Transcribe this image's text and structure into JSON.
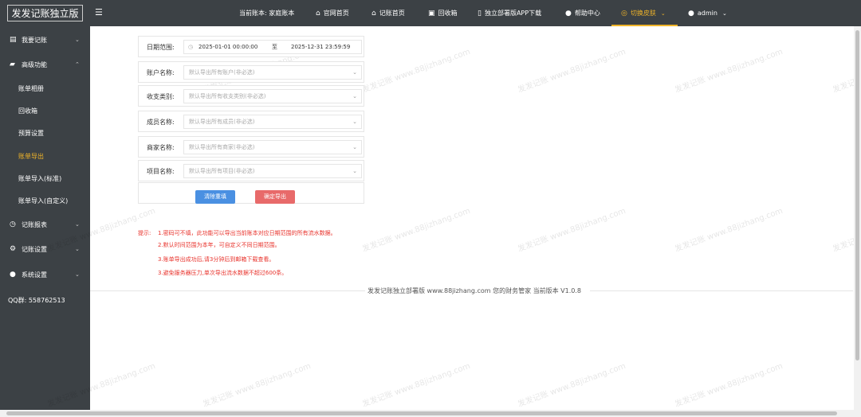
{
  "header": {
    "logo": "发发记账独立版",
    "current_ledger": "当前账本: 家庭账本",
    "nav": [
      {
        "label": "官网首页",
        "icon": "home-icon"
      },
      {
        "label": "记账首页",
        "icon": "home-icon"
      },
      {
        "label": "回收箱",
        "icon": "trash-icon"
      },
      {
        "label": "独立部署版APP下载",
        "icon": "phone-icon"
      },
      {
        "label": "帮助中心",
        "icon": "help-icon"
      },
      {
        "label": "切换皮肤",
        "icon": "palette-icon"
      },
      {
        "label": "admin",
        "icon": "user-icon"
      }
    ]
  },
  "sidebar": {
    "items": [
      {
        "label": "我要记账",
        "icon": "book-icon"
      },
      {
        "label": "高级功能",
        "icon": "briefcase-icon"
      },
      {
        "label": "记账报表",
        "icon": "clock-icon"
      },
      {
        "label": "记账设置",
        "icon": "gear-icon"
      },
      {
        "label": "系统设置",
        "icon": "user-icon"
      }
    ],
    "sub_items": [
      "账单相册",
      "回收箱",
      "预算设置",
      "账单导出",
      "账单导入(标准)",
      "账单导入(自定义)"
    ],
    "qq": "QQ群: 558762513"
  },
  "form": {
    "date_label": "日期范围:",
    "date_start": "2025-01-01 00:00:00",
    "date_sep": "至",
    "date_end": "2025-12-31 23:59:59",
    "fields": [
      {
        "label": "账户名称:",
        "placeholder": "默认导出所有账户(非必选)"
      },
      {
        "label": "收支类别:",
        "placeholder": "默认导出所有收支类别(非必选)"
      },
      {
        "label": "成员名称:",
        "placeholder": "默认导出所有成员(非必选)"
      },
      {
        "label": "商家名称:",
        "placeholder": "默认导出所有商家(非必选)"
      },
      {
        "label": "项目名称:",
        "placeholder": "默认导出所有项目(非必选)"
      }
    ],
    "clear_button": "清除重填",
    "confirm_button": "确定导出"
  },
  "tips": {
    "label": "提示:",
    "lines": [
      "1.密码可不填，此功能可以导出当前账本对应日期范围的所有流水数据。",
      "2.默认时间范围为本年，可自定义不同日期范围。",
      "3.账单导出成功后,请3分钟后到邮箱下载查看。",
      "3.避免服务器压力,单次导出流水数据不超过600条。"
    ]
  },
  "footer": "发发记账独立部署版   www.88jizhang.com   您的财务管家   当前版本 V1.0.8",
  "watermark": "发发记账 www.88jizhang.com",
  "colors": {
    "accent": "#f0b429",
    "sidebar_bg": "#3c4145",
    "tip_red": "#e8322b",
    "btn_blue": "#4a90e2",
    "btn_red": "#e86a6a"
  }
}
